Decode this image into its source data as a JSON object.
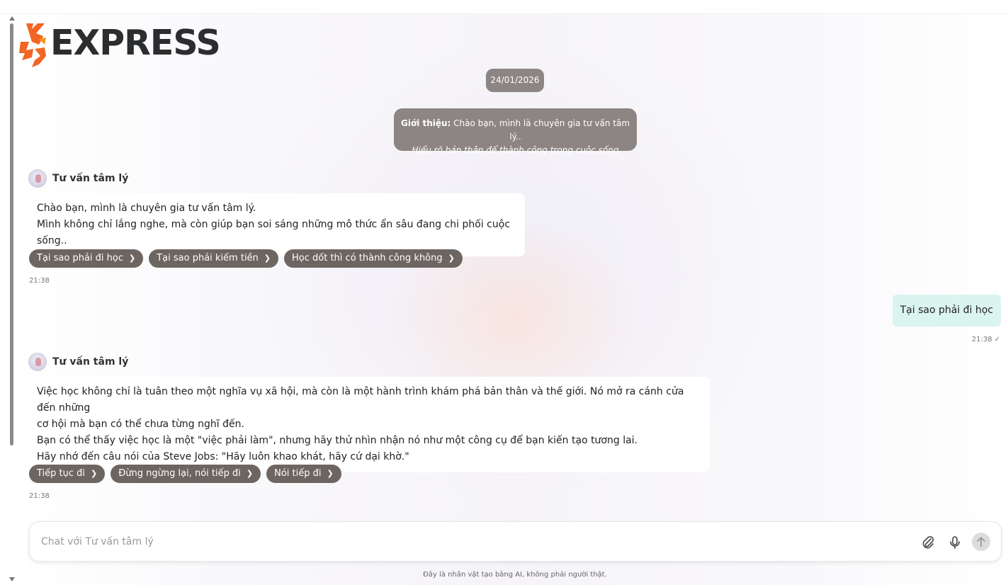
{
  "logo": {
    "text": "EXPRESS"
  },
  "date": "24/01/2026",
  "intro": {
    "label": "Giới thiệu:",
    "text": " Chào bạn, mình là chuyên gia tư vấn tâm lý..",
    "tagline": "Hiểu rõ bản thân để thành công trong cuộc sống"
  },
  "bot_name": "Tư vấn tâm lý",
  "messages": [
    {
      "sender": "bot",
      "lines": [
        "Chào bạn, mình là chuyên gia tư vấn tâm lý.",
        "Mình không chỉ lắng nghe, mà còn giúp bạn soi sáng những mô thức ẩn sâu đang chi phối cuộc sống.."
      ],
      "suggestions": [
        "Tại sao phải đi học",
        "Tại sao phải kiếm tiền",
        "Học dốt thì có thành công không"
      ],
      "time": "21:38"
    },
    {
      "sender": "user",
      "text": "Tại sao phải đi học",
      "time": "21:38",
      "status_icon": "check-icon"
    },
    {
      "sender": "bot",
      "lines": [
        "Việc học không chỉ là tuân theo một nghĩa vụ xã hội, mà còn là một hành trình khám phá bản thân và thế giới. Nó mở ra cánh cửa đến những",
        "cơ hội mà bạn có thể chưa từng nghĩ đến.",
        "Bạn có thể thấy việc học là một \"việc phải làm\", nhưng hãy thử nhìn nhận nó như một công cụ để bạn kiến tạo tương lai.",
        "Hãy nhớ đến câu nói của Steve Jobs: \"Hãy luôn khao khát, hãy cứ dại khờ.\""
      ],
      "suggestions": [
        "Tiếp tục đi",
        "Đừng ngừng lại, nói tiếp đi",
        "Nói tiếp đi"
      ],
      "time": "21:38"
    }
  ],
  "composer": {
    "placeholder": "Chat với Tư vấn tâm lý",
    "value": "",
    "icons": [
      "paperclip-icon",
      "microphone-icon",
      "send-arrow-icon"
    ]
  },
  "disclaimer": "Đây là nhân vật tạo bằng AI, không phải người thật.",
  "colors": {
    "pill_bg": "#8c8583",
    "chip_bg": "#6d6560",
    "user_bubble": "#daf4ef",
    "logo_orange": "#f26522",
    "logo_dark": "#2b2d2f"
  }
}
